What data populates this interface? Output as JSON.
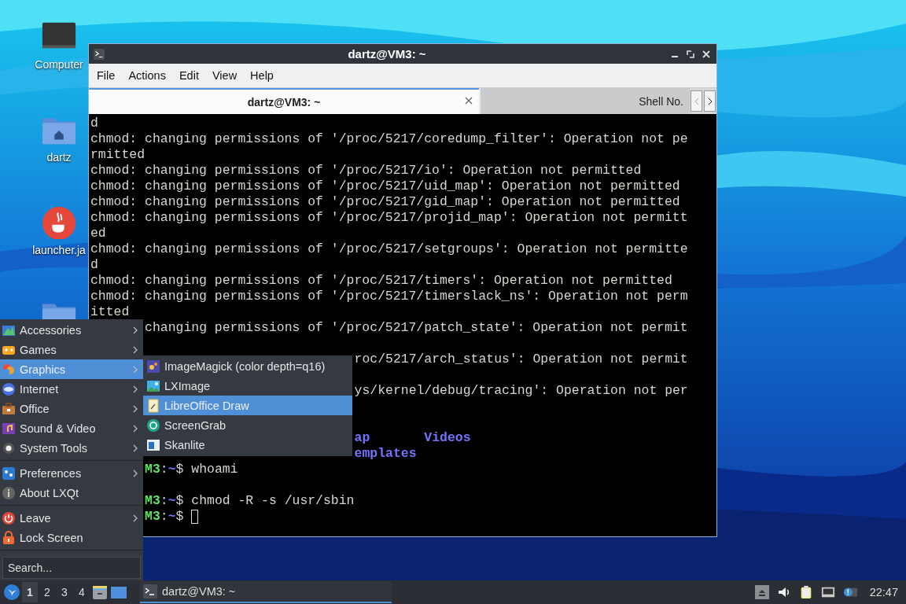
{
  "desktop_icons": [
    {
      "kind": "computer",
      "label": "Computer"
    },
    {
      "kind": "home",
      "label": "dartz"
    },
    {
      "kind": "java",
      "label": "launcher.ja"
    },
    {
      "kind": "folder"
    }
  ],
  "terminal_window": {
    "title": "dartz@VM3: ~",
    "menu": [
      "File",
      "Actions",
      "Edit",
      "View",
      "Help"
    ],
    "tabs": [
      {
        "label": "dartz@VM3: ~",
        "selected": true
      },
      {
        "label": "Shell No.",
        "selected": false
      }
    ],
    "lines": [
      {
        "kind": "full",
        "segments": [
          {
            "kind": "plain",
            "text": "d"
          }
        ]
      },
      {
        "kind": "full",
        "segments": [
          {
            "kind": "plain",
            "text": "chmod: changing permissions of '/proc/5217/coredump_filter': Operation not pe"
          }
        ]
      },
      {
        "kind": "full",
        "segments": [
          {
            "kind": "plain",
            "text": "rmitted"
          }
        ]
      },
      {
        "kind": "full",
        "segments": [
          {
            "kind": "plain",
            "text": "chmod: changing permissions of '/proc/5217/io': Operation not permitted"
          }
        ]
      },
      {
        "kind": "full",
        "segments": [
          {
            "kind": "plain",
            "text": "chmod: changing permissions of '/proc/5217/uid_map': Operation not permitted"
          }
        ]
      },
      {
        "kind": "full",
        "segments": [
          {
            "kind": "plain",
            "text": "chmod: changing permissions of '/proc/5217/gid_map': Operation not permitted"
          }
        ]
      },
      {
        "kind": "full",
        "segments": [
          {
            "kind": "plain",
            "text": "chmod: changing permissions of '/proc/5217/projid_map': Operation not permitt"
          }
        ]
      },
      {
        "kind": "full",
        "segments": [
          {
            "kind": "plain",
            "text": "ed"
          }
        ]
      },
      {
        "kind": "full",
        "segments": [
          {
            "kind": "plain",
            "text": "chmod: changing permissions of '/proc/5217/setgroups': Operation not permitte"
          }
        ]
      },
      {
        "kind": "full",
        "segments": [
          {
            "kind": "plain",
            "text": "d"
          }
        ]
      },
      {
        "kind": "full",
        "segments": [
          {
            "kind": "plain",
            "text": "chmod: changing permissions of '/proc/5217/timers': Operation not permitted"
          }
        ]
      },
      {
        "kind": "full",
        "segments": [
          {
            "kind": "plain",
            "text": "chmod: changing permissions of '/proc/5217/timerslack_ns': Operation not perm"
          }
        ]
      },
      {
        "kind": "full",
        "segments": [
          {
            "kind": "plain",
            "text": "itted"
          }
        ]
      },
      {
        "kind": "under_menu",
        "segments": [
          {
            "kind": "plain",
            "text": "changing permissions of '/proc/5217/patch_state': Operation not permit"
          }
        ]
      },
      {
        "kind": "blank"
      },
      {
        "kind": "under_submenu",
        "segments": [
          {
            "kind": "plain",
            "text": "roc/5217/arch_status': Operation not permit"
          }
        ]
      },
      {
        "kind": "blank"
      },
      {
        "kind": "under_submenu",
        "segments": [
          {
            "kind": "plain",
            "text": "ys/kernel/debug/tracing': Operation not per"
          }
        ]
      },
      {
        "kind": "blank"
      },
      {
        "kind": "blank"
      },
      {
        "kind": "under_submenu",
        "segments": [
          {
            "kind": "dir",
            "text": "ap       Videos"
          }
        ]
      },
      {
        "kind": "under_submenu",
        "segments": [
          {
            "kind": "dir",
            "text": "emplates"
          }
        ]
      },
      {
        "kind": "under_menu",
        "segments": [
          {
            "kind": "host",
            "text": "M3"
          },
          {
            "kind": "plain",
            "text": ":"
          },
          {
            "kind": "path",
            "text": "~"
          },
          {
            "kind": "plain",
            "text": "$ whoami"
          }
        ]
      },
      {
        "kind": "blank"
      },
      {
        "kind": "under_menu",
        "segments": [
          {
            "kind": "host",
            "text": "M3"
          },
          {
            "kind": "plain",
            "text": ":"
          },
          {
            "kind": "path",
            "text": "~"
          },
          {
            "kind": "plain",
            "text": "$ chmod -R -s /usr/sbin"
          }
        ]
      },
      {
        "kind": "under_menu",
        "segments": [
          {
            "kind": "host",
            "text": "M3"
          },
          {
            "kind": "plain",
            "text": ":"
          },
          {
            "kind": "path",
            "text": "~"
          },
          {
            "kind": "plain",
            "text": "$ "
          },
          {
            "kind": "cursor"
          }
        ]
      }
    ]
  },
  "start_menu": {
    "sections": [
      [
        {
          "kind": "accessories",
          "label": "Accessories",
          "submenu": true,
          "selected": false
        },
        {
          "kind": "games",
          "label": "Games",
          "submenu": true,
          "selected": false
        },
        {
          "kind": "graphics",
          "label": "Graphics",
          "submenu": true,
          "selected": true
        },
        {
          "kind": "internet",
          "label": "Internet",
          "submenu": true,
          "selected": false
        },
        {
          "kind": "office",
          "label": "Office",
          "submenu": true,
          "selected": false
        },
        {
          "kind": "sound",
          "label": "Sound & Video",
          "submenu": true,
          "selected": false
        },
        {
          "kind": "system",
          "label": "System Tools",
          "submenu": true,
          "selected": false
        }
      ],
      [
        {
          "kind": "preferences",
          "label": "Preferences",
          "submenu": true,
          "selected": false
        },
        {
          "kind": "about",
          "label": "About LXQt",
          "submenu": false,
          "selected": false
        }
      ],
      [
        {
          "kind": "leave",
          "label": "Leave",
          "submenu": true,
          "selected": false
        },
        {
          "kind": "lock",
          "label": "Lock Screen",
          "submenu": false,
          "selected": false
        }
      ]
    ],
    "search": {
      "placeholder": "Search..."
    }
  },
  "submenu": [
    {
      "kind": "imagemagick",
      "label": "ImageMagick (color depth=q16)",
      "selected": false
    },
    {
      "kind": "lximage",
      "label": "LXImage",
      "selected": false
    },
    {
      "kind": "draw",
      "label": "LibreOffice Draw",
      "selected": true
    },
    {
      "kind": "screengrab",
      "label": "ScreenGrab",
      "selected": false
    },
    {
      "kind": "skanlite",
      "label": "Skanlite",
      "selected": false
    }
  ],
  "taskbar": {
    "workspaces": [
      {
        "label": "1",
        "selected": true
      },
      {
        "label": "2",
        "selected": false
      },
      {
        "label": "3",
        "selected": false
      },
      {
        "label": "4",
        "selected": false
      }
    ],
    "tasks": [
      {
        "label": "dartz@VM3: ~",
        "selected": true
      }
    ],
    "clock": "22:47"
  }
}
